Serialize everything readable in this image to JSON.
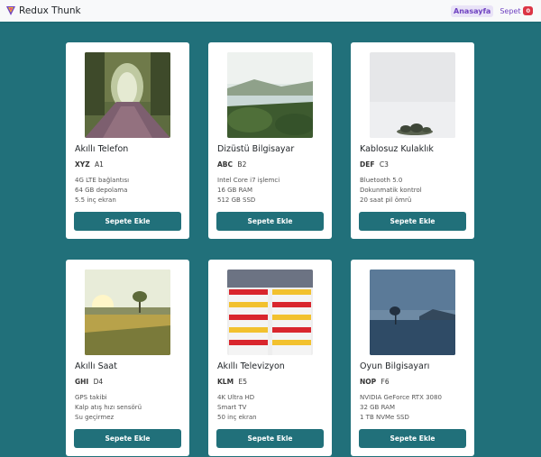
{
  "navbar": {
    "brand": "Redux Thunk",
    "home_label": "Anasayfa",
    "cart_label": "Sepet",
    "cart_count": "0"
  },
  "colors": {
    "background": "#21707a",
    "button": "#21707a",
    "badge": "#dc3545",
    "nav_link": "#6f42c1"
  },
  "products": [
    {
      "name": "Akıllı Telefon",
      "brand": "XYZ",
      "model": "A1",
      "specs": [
        "4G LTE bağlantısı",
        "64 GB depolama",
        "5.5 inç ekran"
      ],
      "button": "Sepete Ekle"
    },
    {
      "name": "Dizüstü Bilgisayar",
      "brand": "ABC",
      "model": "B2",
      "specs": [
        "Intel Core i7 işlemci",
        "16 GB RAM",
        "512 GB SSD"
      ],
      "button": "Sepete Ekle"
    },
    {
      "name": "Kablosuz Kulaklık",
      "brand": "DEF",
      "model": "C3",
      "specs": [
        "Bluetooth 5.0",
        "Dokunmatik kontrol",
        "20 saat pil ömrü"
      ],
      "button": "Sepete Ekle"
    },
    {
      "name": "Akıllı Saat",
      "brand": "GHI",
      "model": "D4",
      "specs": [
        "GPS takibi",
        "Kalp atış hızı sensörü",
        "Su geçirmez"
      ],
      "button": "Sepete Ekle"
    },
    {
      "name": "Akıllı Televizyon",
      "brand": "KLM",
      "model": "E5",
      "specs": [
        "4K Ultra HD",
        "Smart TV",
        "50 inç ekran"
      ],
      "button": "Sepete Ekle"
    },
    {
      "name": "Oyun Bilgisayarı",
      "brand": "NOP",
      "model": "F6",
      "specs": [
        "NVIDIA GeForce RTX 3080",
        "32 GB RAM",
        "1 TB NVMe SSD"
      ],
      "button": "Sepete Ekle"
    }
  ]
}
